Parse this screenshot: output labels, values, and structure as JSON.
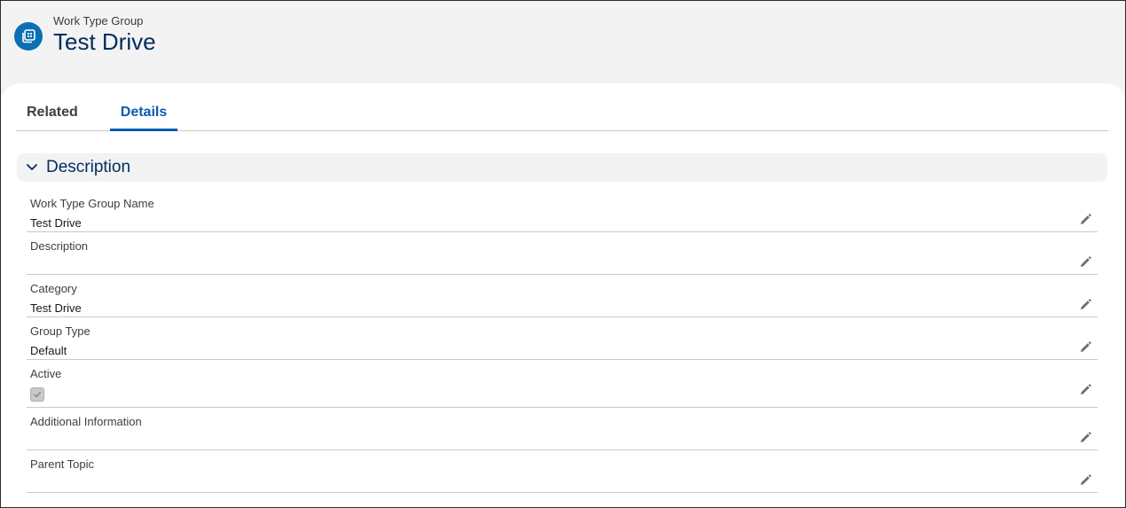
{
  "header": {
    "object_label": "Work Type Group",
    "record_title": "Test Drive",
    "icon": "work-type-group-icon",
    "icon_color": "#0b6fb3"
  },
  "tabs": [
    {
      "label": "Related",
      "active": false
    },
    {
      "label": "Details",
      "active": true
    }
  ],
  "section": {
    "title": "Description",
    "expanded": true
  },
  "fields": [
    {
      "label": "Work Type Group Name",
      "value": "Test Drive"
    },
    {
      "label": "Description",
      "value": ""
    },
    {
      "label": "Category",
      "value": "Test Drive"
    },
    {
      "label": "Group Type",
      "value": "Default"
    },
    {
      "label": "Active",
      "checked": true,
      "disabled": true
    },
    {
      "label": "Additional Information",
      "value": ""
    },
    {
      "label": "Parent Topic",
      "value": ""
    }
  ],
  "colors": {
    "accent": "#0b5cab",
    "title": "#032d60",
    "header_bg": "#f3f3f3"
  }
}
